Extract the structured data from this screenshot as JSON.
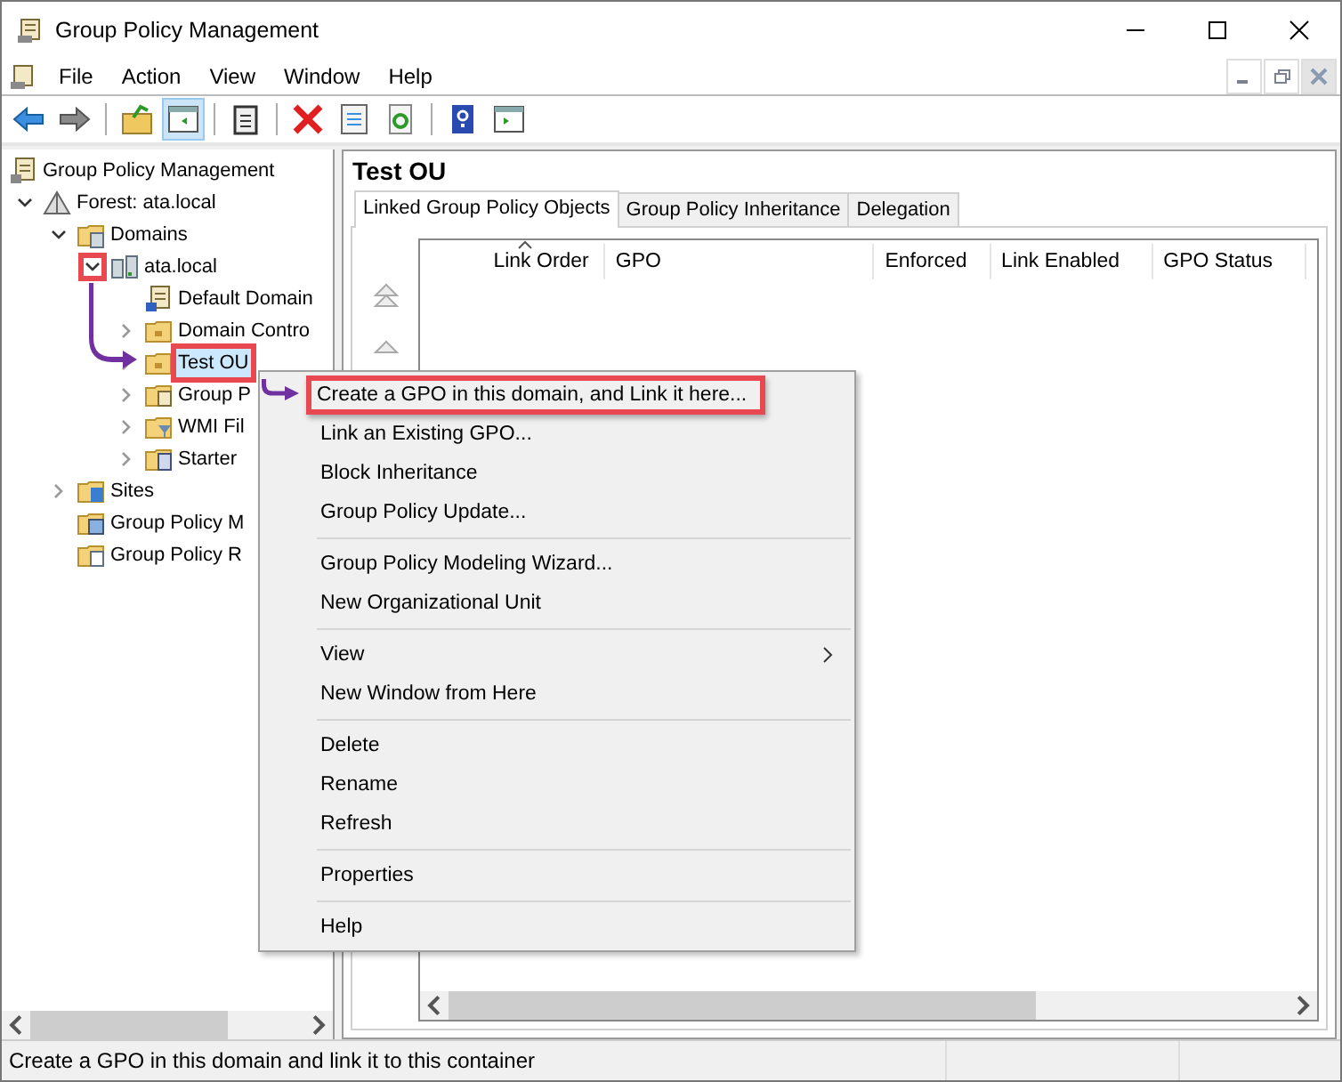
{
  "window": {
    "title": "Group Policy Management"
  },
  "menu_bar": [
    "File",
    "Action",
    "View",
    "Window",
    "Help"
  ],
  "toolbar": [
    [
      {
        "kind": "back",
        "pressed": false
      },
      {
        "kind": "forward",
        "pressed": false
      }
    ],
    [
      {
        "kind": "up",
        "pressed": false
      },
      {
        "kind": "tree",
        "pressed": true
      }
    ],
    [
      {
        "kind": "clipboard",
        "pressed": false
      }
    ],
    [
      {
        "kind": "delete",
        "pressed": false
      },
      {
        "kind": "properties",
        "pressed": false
      },
      {
        "kind": "refresh",
        "pressed": false
      }
    ],
    [
      {
        "kind": "help",
        "pressed": false
      },
      {
        "kind": "pane",
        "pressed": false
      }
    ]
  ],
  "tree": [
    {
      "label": "Group Policy Management",
      "kind": "root",
      "selected": false,
      "highlighted": false,
      "children": [
        {
          "label": "Forest: ata.local",
          "kind": "forest",
          "expanded": true,
          "selected": false,
          "highlighted": false,
          "toggle_highlighted": false,
          "children": [
            {
              "label": "Domains",
              "kind": "domains",
              "expanded": true,
              "selected": false,
              "highlighted": false,
              "toggle_highlighted": false,
              "children": [
                {
                  "label": "ata.local",
                  "kind": "domain",
                  "expanded": true,
                  "selected": false,
                  "highlighted": false,
                  "toggle_highlighted": true,
                  "children": [
                    {
                      "label": "Default Domain",
                      "kind": "gpo",
                      "selected": false,
                      "highlighted": false
                    },
                    {
                      "label": "Domain Contro",
                      "kind": "folder",
                      "expanded": false,
                      "selected": false,
                      "highlighted": false,
                      "toggle_highlighted": false
                    },
                    {
                      "label": "Test OU",
                      "kind": "folder",
                      "expanded": false,
                      "selected": true,
                      "highlighted": true,
                      "toggle_highlighted": false
                    },
                    {
                      "label": "Group P",
                      "kind": "gpo-folder",
                      "expanded": false,
                      "selected": false,
                      "highlighted": false,
                      "toggle_highlighted": false
                    },
                    {
                      "label": "WMI Fil",
                      "kind": "filter-folder",
                      "expanded": false,
                      "selected": false,
                      "highlighted": false,
                      "toggle_highlighted": false
                    },
                    {
                      "label": "Starter",
                      "kind": "starter-folder",
                      "expanded": false,
                      "selected": false,
                      "highlighted": false,
                      "toggle_highlighted": false
                    }
                  ]
                }
              ]
            },
            {
              "label": "Sites",
              "kind": "sites",
              "expanded": false,
              "selected": false,
              "highlighted": false,
              "toggle_highlighted": false
            },
            {
              "label": "Group Policy M",
              "kind": "modeling",
              "selected": false,
              "highlighted": false
            },
            {
              "label": "Group Policy R",
              "kind": "results",
              "selected": false,
              "highlighted": false
            }
          ]
        }
      ]
    }
  ],
  "details": {
    "title": "Test OU",
    "tabs": [
      {
        "label": "Linked Group Policy Objects",
        "selected": true
      },
      {
        "label": "Group Policy Inheritance",
        "selected": false
      },
      {
        "label": "Delegation",
        "selected": false
      }
    ],
    "columns": [
      {
        "label": "Link Order",
        "sorted": true
      },
      {
        "label": "GPO",
        "sorted": false
      },
      {
        "label": "Enforced",
        "sorted": false
      },
      {
        "label": "Link Enabled",
        "sorted": false
      },
      {
        "label": "GPO Status",
        "sorted": false
      }
    ]
  },
  "context_menu": [
    [
      {
        "label": "Create a GPO in this domain, and Link it here...",
        "submenu": false,
        "highlighted": true
      },
      {
        "label": "Link an Existing GPO...",
        "submenu": false,
        "highlighted": false
      },
      {
        "label": "Block Inheritance",
        "submenu": false,
        "highlighted": false
      },
      {
        "label": "Group Policy Update...",
        "submenu": false,
        "highlighted": false
      }
    ],
    [
      {
        "label": "Group Policy Modeling Wizard...",
        "submenu": false,
        "highlighted": false
      },
      {
        "label": "New Organizational Unit",
        "submenu": false,
        "highlighted": false
      }
    ],
    [
      {
        "label": "View",
        "submenu": true,
        "highlighted": false
      },
      {
        "label": "New Window from Here",
        "submenu": false,
        "highlighted": false
      }
    ],
    [
      {
        "label": "Delete",
        "submenu": false,
        "highlighted": false
      },
      {
        "label": "Rename",
        "submenu": false,
        "highlighted": false
      },
      {
        "label": "Refresh",
        "submenu": false,
        "highlighted": false
      }
    ],
    [
      {
        "label": "Properties",
        "submenu": false,
        "highlighted": false
      }
    ],
    [
      {
        "label": "Help",
        "submenu": false,
        "highlighted": false
      }
    ]
  ],
  "status_bar": "Create a GPO in this domain and link it to this container"
}
